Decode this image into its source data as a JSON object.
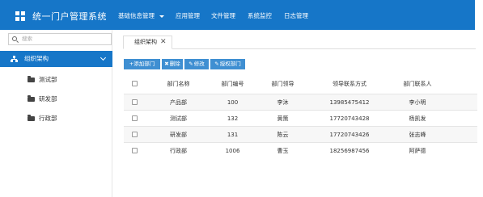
{
  "header": {
    "app_title": "统一门户管理系统",
    "nav": [
      {
        "label": "基础信息管理",
        "has_caret": true
      },
      {
        "label": "应用管理"
      },
      {
        "label": "文件管理"
      },
      {
        "label": "系统监控"
      },
      {
        "label": "日志管理"
      }
    ]
  },
  "sidebar": {
    "search_placeholder": "搜索",
    "menu_header": "组织架构",
    "items": [
      {
        "label": "测试部"
      },
      {
        "label": "研发部"
      },
      {
        "label": "行政部"
      }
    ]
  },
  "tabs": [
    {
      "label": "组织架构",
      "close": "✕"
    }
  ],
  "toolbar": {
    "add": "+添加部门",
    "delete": "删除",
    "edit": "修改",
    "authorize": "授权部门"
  },
  "table": {
    "columns": [
      "部门名称",
      "部门编号",
      "部门领导",
      "领导联系方式",
      "部门联系人"
    ],
    "rows": [
      [
        "产品部",
        "100",
        "李沐",
        "13985475412",
        "李小明"
      ],
      [
        "测试部",
        "132",
        "黄策",
        "17720743428",
        "杨凯发"
      ],
      [
        "研发部",
        "131",
        "陈云",
        "17720743426",
        "张志峰"
      ],
      [
        "行政部",
        "1006",
        "曹玉",
        "18256987456",
        "阿萨德"
      ]
    ]
  },
  "colors": {
    "brand_blue": "#1676c8",
    "button_blue": "#3f8fd2"
  }
}
